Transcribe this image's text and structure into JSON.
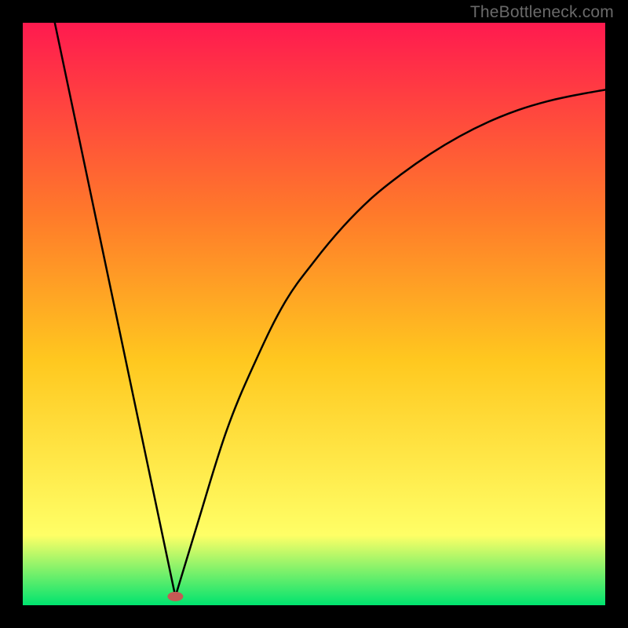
{
  "watermark": "TheBottleneck.com",
  "chart_data": {
    "type": "line",
    "title": "",
    "xlabel": "",
    "ylabel": "",
    "xlim": [
      0,
      100
    ],
    "ylim": [
      0,
      100
    ],
    "grid": false,
    "legend": false,
    "gradient_bg": {
      "top": "#ff1a4f",
      "mid_upper": "#ff7a2a",
      "mid": "#ffc81f",
      "mid_lower": "#ffff66",
      "bottom": "#00e36f"
    },
    "series": [
      {
        "name": "left-branch",
        "x": [
          5.5,
          26.2
        ],
        "y": [
          100,
          1.5
        ]
      },
      {
        "name": "right-branch",
        "x": [
          26.2,
          30,
          35,
          40,
          45,
          50,
          55,
          60,
          65,
          70,
          75,
          80,
          85,
          90,
          95,
          100
        ],
        "y": [
          1.5,
          14,
          30,
          42,
          52,
          59,
          65,
          70,
          74,
          77.5,
          80.5,
          83,
          85,
          86.5,
          87.6,
          88.5
        ]
      }
    ],
    "markers": [
      {
        "name": "valley-marker",
        "x": 26.2,
        "y": 1.5,
        "color": "#c45a55",
        "shape": "lozenge"
      }
    ]
  }
}
